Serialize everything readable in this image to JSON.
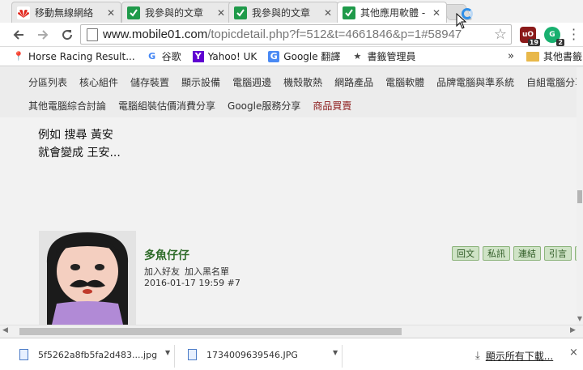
{
  "tabs": [
    {
      "title": "移動無線網絡",
      "active": false,
      "icon": "huawei-icon"
    },
    {
      "title": "我參與的文章",
      "active": false,
      "icon": "mobile01-icon"
    },
    {
      "title": "我參與的文章",
      "active": false,
      "icon": "mobile01-icon"
    },
    {
      "title": "其他應用軟體 -",
      "active": true,
      "icon": "mobile01-icon"
    }
  ],
  "toolbar": {
    "url_domain": "www.mobile01.com",
    "url_path": "/topicdetail.php?f=512&t=4661846&p=1#58947",
    "ublock_badge": "19",
    "grammarly_badge": "2"
  },
  "bookmarks": {
    "items": [
      {
        "label": "Horse Racing Result...",
        "icon": "pin-icon"
      },
      {
        "label": "谷歌",
        "icon": "google-icon"
      },
      {
        "label": "Yahoo! UK",
        "icon": "yahoo-icon"
      },
      {
        "label": "Google 翻譯",
        "icon": "google-translate-icon"
      },
      {
        "label": "書籤管理員",
        "icon": "star-icon"
      }
    ],
    "more": "»",
    "other": "其他書籤"
  },
  "category_nav": {
    "row1": [
      "分區列表",
      "核心組件",
      "儲存裝置",
      "顯示設備",
      "電腦週邊",
      "機殼散熱",
      "網路產品",
      "電腦軟體",
      "品牌電腦與準系統",
      "自組電腦分享"
    ],
    "row2": [
      "其他電腦綜合討論",
      "電腦組裝估價消費分享",
      "Google服務分享",
      "商品買賣"
    ]
  },
  "post": {
    "line1": "例如 搜尋 黃安",
    "line2": "就會變成 王安..."
  },
  "author": {
    "name": "多魚仔仔",
    "add_friend": "加入好友",
    "add_blacklist": "加入黑名單",
    "date": "2016-01-17 19:59",
    "floor": "#7"
  },
  "post_actions": [
    "回文",
    "私訊",
    "連結",
    "引言",
    ""
  ],
  "downloads": [
    {
      "name": "5f5262a8fb5fa2d483....jpg"
    },
    {
      "name": "1734009639546.JPG"
    }
  ],
  "shelf": {
    "show_all": "顯示所有下載...",
    "close": "×"
  }
}
